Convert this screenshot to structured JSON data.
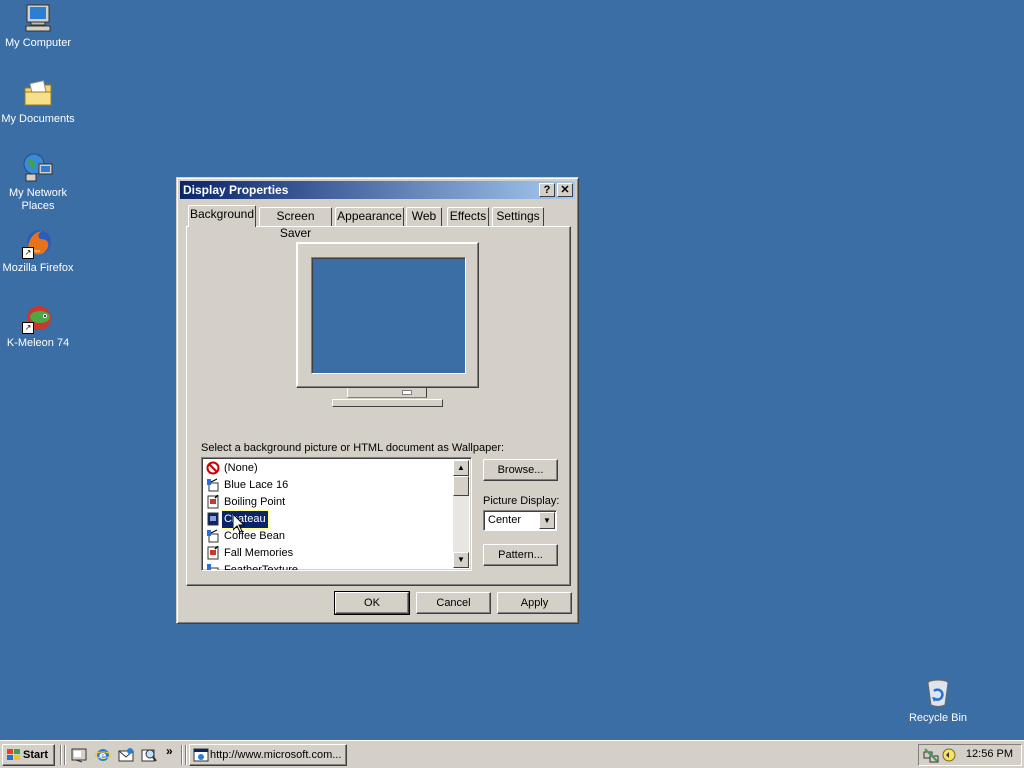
{
  "desktop": {
    "background": "#3a6ea5",
    "icons": [
      {
        "label": "My Computer",
        "icon": "computer-icon"
      },
      {
        "label": "My Documents",
        "icon": "folder-documents-icon"
      },
      {
        "label": "My Network Places",
        "icon": "network-icon"
      },
      {
        "label": "Mozilla Firefox",
        "icon": "firefox-icon"
      },
      {
        "label": "K-Meleon 74",
        "icon": "kmeleon-icon"
      },
      {
        "label": "Recycle Bin",
        "icon": "recycle-bin-icon"
      }
    ]
  },
  "window": {
    "title": "Display Properties",
    "help_glyph": "?",
    "close_glyph": "✕",
    "tabs": [
      {
        "label": "Background"
      },
      {
        "label": "Screen Saver"
      },
      {
        "label": "Appearance"
      },
      {
        "label": "Web"
      },
      {
        "label": "Effects"
      },
      {
        "label": "Settings"
      }
    ],
    "active_tab": "Background",
    "wallpaper_prompt": "Select a background picture or HTML document as Wallpaper:",
    "wallpaper_list": [
      {
        "label": "(None)",
        "icon": "none-icon"
      },
      {
        "label": "Blue Lace 16",
        "icon": "paint-icon"
      },
      {
        "label": "Boiling Point",
        "icon": "html-document-icon"
      },
      {
        "label": "Chateau",
        "icon": "html-document-icon",
        "selected": true
      },
      {
        "label": "Coffee Bean",
        "icon": "paint-icon"
      },
      {
        "label": "Fall Memories",
        "icon": "html-document-icon"
      },
      {
        "label": "FeatherTexture",
        "icon": "paint-icon"
      }
    ],
    "browse_label": "Browse...",
    "picture_display_label": "Picture Display:",
    "picture_display_value": "Center",
    "pattern_label": "Pattern...",
    "ok_label": "OK",
    "cancel_label": "Cancel",
    "apply_label": "Apply"
  },
  "taskbar": {
    "start_label": "Start",
    "chevron": "»",
    "task_label": "http://www.microsoft.com...",
    "clock": "12:56 PM",
    "quick_launch": [
      "show-desktop-icon",
      "internet-explorer-icon",
      "outlook-express-icon",
      "search-icon"
    ]
  }
}
